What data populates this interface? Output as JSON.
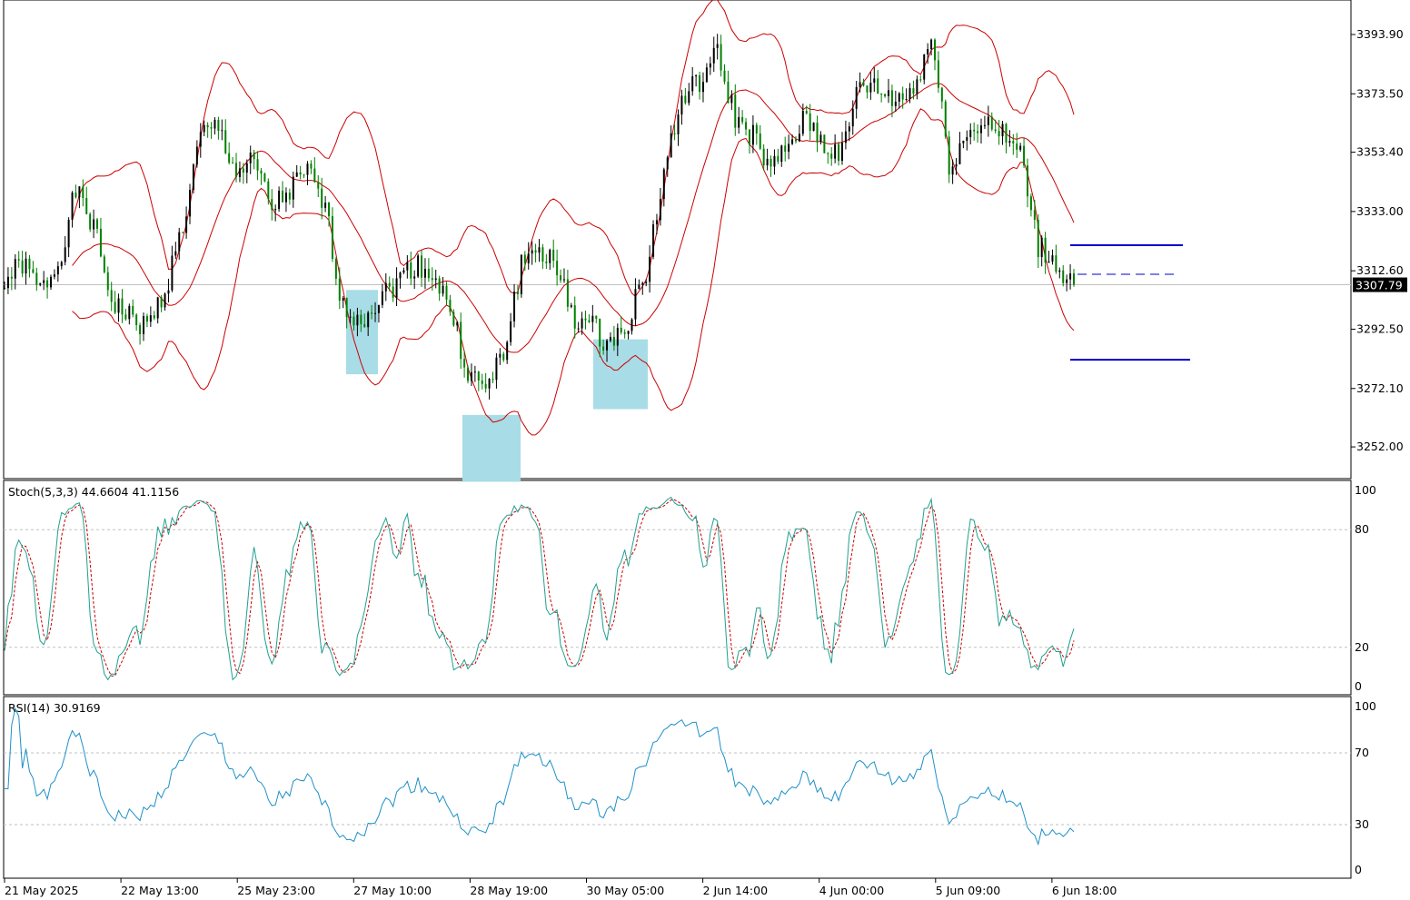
{
  "chart_data": {
    "type": "candlestick",
    "symbol_panel": "price",
    "price_axis_ticks": [
      3393.9,
      3373.5,
      3353.4,
      3333.0,
      3312.6,
      3292.5,
      3272.1,
      3252.0
    ],
    "price_axis_tick_labels": [
      "3393.90",
      "3373.50",
      "3353.40",
      "3333.00",
      "3312.60",
      "3292.50",
      "3272.10",
      "3252.00"
    ],
    "current_price": "3307.79",
    "time_axis_labels": [
      "21 May 2025",
      "22 May 13:00",
      "25 May 23:00",
      "27 May 10:00",
      "28 May 19:00",
      "30 May 05:00",
      "2 Jun 14:00",
      "4 Jun 00:00",
      "5 Jun 09:00",
      "6 Jun 18:00"
    ],
    "approx_closes": [
      3308.9,
      3315,
      3305.8,
      3315,
      3340,
      3327.6,
      3302.6,
      3296.4,
      3293,
      3305.8,
      3327.6,
      3358.9,
      3362,
      3346.4,
      3349.5,
      3333.9,
      3340,
      3346.4,
      3333.9,
      3299.5,
      3296.4,
      3302.6,
      3308.9,
      3315,
      3312,
      3299.5,
      3277.6,
      3271.4,
      3283.9,
      3315,
      3321,
      3312,
      3296.4,
      3293,
      3287,
      3296.4,
      3312,
      3346.4,
      3371.4,
      3377.7,
      3387,
      3365,
      3358.9,
      3346.4,
      3355.8,
      3365,
      3355.8,
      3352.6,
      3377.7,
      3374.6,
      3371.4,
      3374.6,
      3393.3,
      3349.5,
      3358.9,
      3365,
      3358.9,
      3352.6,
      3321,
      3315,
      3307.8
    ],
    "bollinger": {
      "period": 20,
      "deviation": 2,
      "color": "#cc0000"
    },
    "colors": {
      "bull": "#000000",
      "bear": "#008000",
      "grid": "#c0c0c0",
      "stoch_main": "#20a090",
      "stoch_signal": "#cc0000",
      "rsi": "#1e90c8",
      "zone": "#a8dce6",
      "level": "#0000cc"
    },
    "zones": [
      {
        "from_label": "27 May",
        "price_top": 3306,
        "price_bottom": 3277
      },
      {
        "from_label": "28 May",
        "price_top": 3263,
        "price_bottom": 3240
      },
      {
        "from_label": "30 May",
        "price_top": 3289,
        "price_bottom": 3265
      }
    ],
    "levels": [
      {
        "price": 3321.4,
        "style": "solid"
      },
      {
        "price": 3311.4,
        "style": "dashed"
      },
      {
        "price": 3282.0,
        "style": "solid"
      }
    ],
    "stochastic": {
      "label": "Stoch(5,3,3) 44.6604 41.1156",
      "levels": [
        20,
        80
      ],
      "ticks": [
        "100",
        "80",
        "20",
        "0"
      ]
    },
    "rsi": {
      "label": "RSI(14) 30.9169",
      "levels": [
        30,
        70
      ],
      "ticks": [
        "100",
        "70",
        "30",
        "0"
      ]
    }
  }
}
